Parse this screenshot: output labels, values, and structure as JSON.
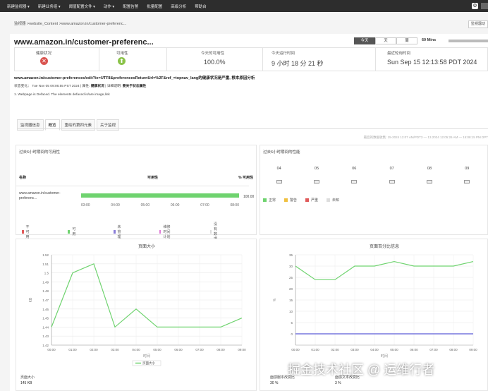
{
  "topnav": {
    "items": [
      "新建监视器 ▾",
      "新建业务组 ▾",
      "阈值配置文件 ▾",
      "动作 ▾",
      "配置告警",
      "批量配置",
      "高级分析",
      "帮助台"
    ],
    "gear_icon": "gear-icon"
  },
  "breadcrumb": "监视器 >website_Content >www.amazon.in/customer-preferenc...",
  "extra_button": "監視器动",
  "monitor": {
    "url_title": "www.amazon.in/customer-preferenc...",
    "period_tabs": [
      "今天",
      "天",
      "周"
    ],
    "active_period": "今天",
    "poll_interval": "60 Mins"
  },
  "status": {
    "health_label": "健康状况",
    "health_state": "critical",
    "availability_label": "可用性",
    "availability_state": "up",
    "today_availability_label": "今天的可用性",
    "today_availability_value": "100.0%",
    "uptime_label": "今天运行时间",
    "uptime_value": "9 小时 18 分 21 秒",
    "last_poll_label": "最近轮询时间",
    "last_poll_value": "Sun Sep 15 12:13:58 PDT 2024"
  },
  "info": {
    "full_url": "www.amazon.in/customer-preferences/edit?ie=UTF8&preferencesReturnUrl=%2F&ref_=topnav_lang的健康状况是严重, 根本原因分析",
    "meta_prefix": "状态变化：",
    "meta_time": "Tue Nov 05 09:06:55 PST 2024",
    "meta_mid": "| 属性:",
    "meta_bold1": "健康状况",
    "meta_mid2": "| 详细说明:",
    "meta_bold2": "要关于状态属性",
    "note": "1. Webpage is Defaced. The elements defaced is/are image,link"
  },
  "subtabs": [
    "监视器信息",
    "概览",
    "重绘的第四元素",
    "关于监视"
  ],
  "active_subtab": "概览",
  "timestamp": "最后的数据收集: 15-2024 12:07 AM/PDT3 — 13.2024 12:05:26 AM — 15:08:15 PM DPT",
  "availability_panel": {
    "title": "过去6小时期间的可用性",
    "col_name": "名称",
    "col_availability": "可用性",
    "col_pct": "% 可用性",
    "row_name": "www.amazon.in/customer-preferenc...",
    "row_pct": "100.00",
    "availability_fraction": 1.0,
    "axis_times": [
      "03:00",
      "04:00",
      "05:00",
      "06:00",
      "07:00",
      "08:00"
    ],
    "legend": [
      {
        "label": "不可用",
        "color": "#e05a5a"
      },
      {
        "label": "可用",
        "color": "#6fd36f"
      },
      {
        "label": "未管理",
        "color": "#8a7dd8"
      },
      {
        "label": "维修时间计划",
        "color": "#e07ad8"
      },
      {
        "label": "没有数据",
        "color": "#dddddd"
      }
    ]
  },
  "performance_panel": {
    "title": "过去6小时期间的性能",
    "hours": [
      "04",
      "05",
      "06",
      "07",
      "08",
      "09"
    ],
    "legend": [
      {
        "label": "正常",
        "color": "#6fd36f"
      },
      {
        "label": "警告",
        "color": "#f0c040"
      },
      {
        "label": "严重",
        "color": "#e05a5a"
      },
      {
        "label": "未知",
        "color": "#dddddd"
      }
    ]
  },
  "charts_footer": {
    "page_size_label": "页面大小",
    "page_size_value": "145 KB",
    "text_change_label": "面感服本改变比",
    "text_change_value": "30 %",
    "image_change_label": "面感文本改变比",
    "image_change_value": "3 %"
  },
  "chart_data": [
    {
      "type": "line",
      "title": "页面大小",
      "xlabel": "时间",
      "ylabel": "KB",
      "x": [
        "00:00",
        "01:00",
        "02:00",
        "03:00",
        "04:00",
        "05:00",
        "06:00",
        "07:00",
        "08:00",
        "09:00"
      ],
      "series": [
        {
          "name": "页面大小",
          "color": "#6fd36f",
          "values": [
            1.44,
            1.5,
            1.51,
            1.44,
            1.46,
            1.44,
            1.44,
            1.44,
            1.44,
            1.45
          ]
        }
      ],
      "yticks": [
        "1.42",
        "1.43",
        "1.44",
        "1.45",
        "1.46",
        "1.47",
        "1.48",
        "1.49",
        "1.5",
        "1.51",
        "1.52"
      ],
      "ylim": [
        1.42,
        1.52
      ]
    },
    {
      "type": "line",
      "title": "页面百分比信息",
      "xlabel": "时间",
      "ylabel": "%",
      "x": [
        "00:00",
        "01:00",
        "02:00",
        "03:00",
        "04:00",
        "05:00",
        "06:00",
        "07:00",
        "08:00",
        "09:00"
      ],
      "series": [
        {
          "name": "",
          "color": "#6fd36f",
          "values": [
            30,
            24,
            24,
            30,
            30,
            32,
            30,
            30,
            30,
            32
          ]
        },
        {
          "name": "",
          "color": "#5b5bd6",
          "values": [
            0,
            0,
            0,
            0,
            0,
            0,
            0,
            0,
            0,
            0
          ]
        }
      ],
      "yticks": [
        "0",
        "5",
        "10",
        "15",
        "20",
        "25",
        "30",
        "35"
      ],
      "ylim": [
        -5,
        35
      ]
    }
  ],
  "watermark": "掘金技术社区 @ 运维行者"
}
